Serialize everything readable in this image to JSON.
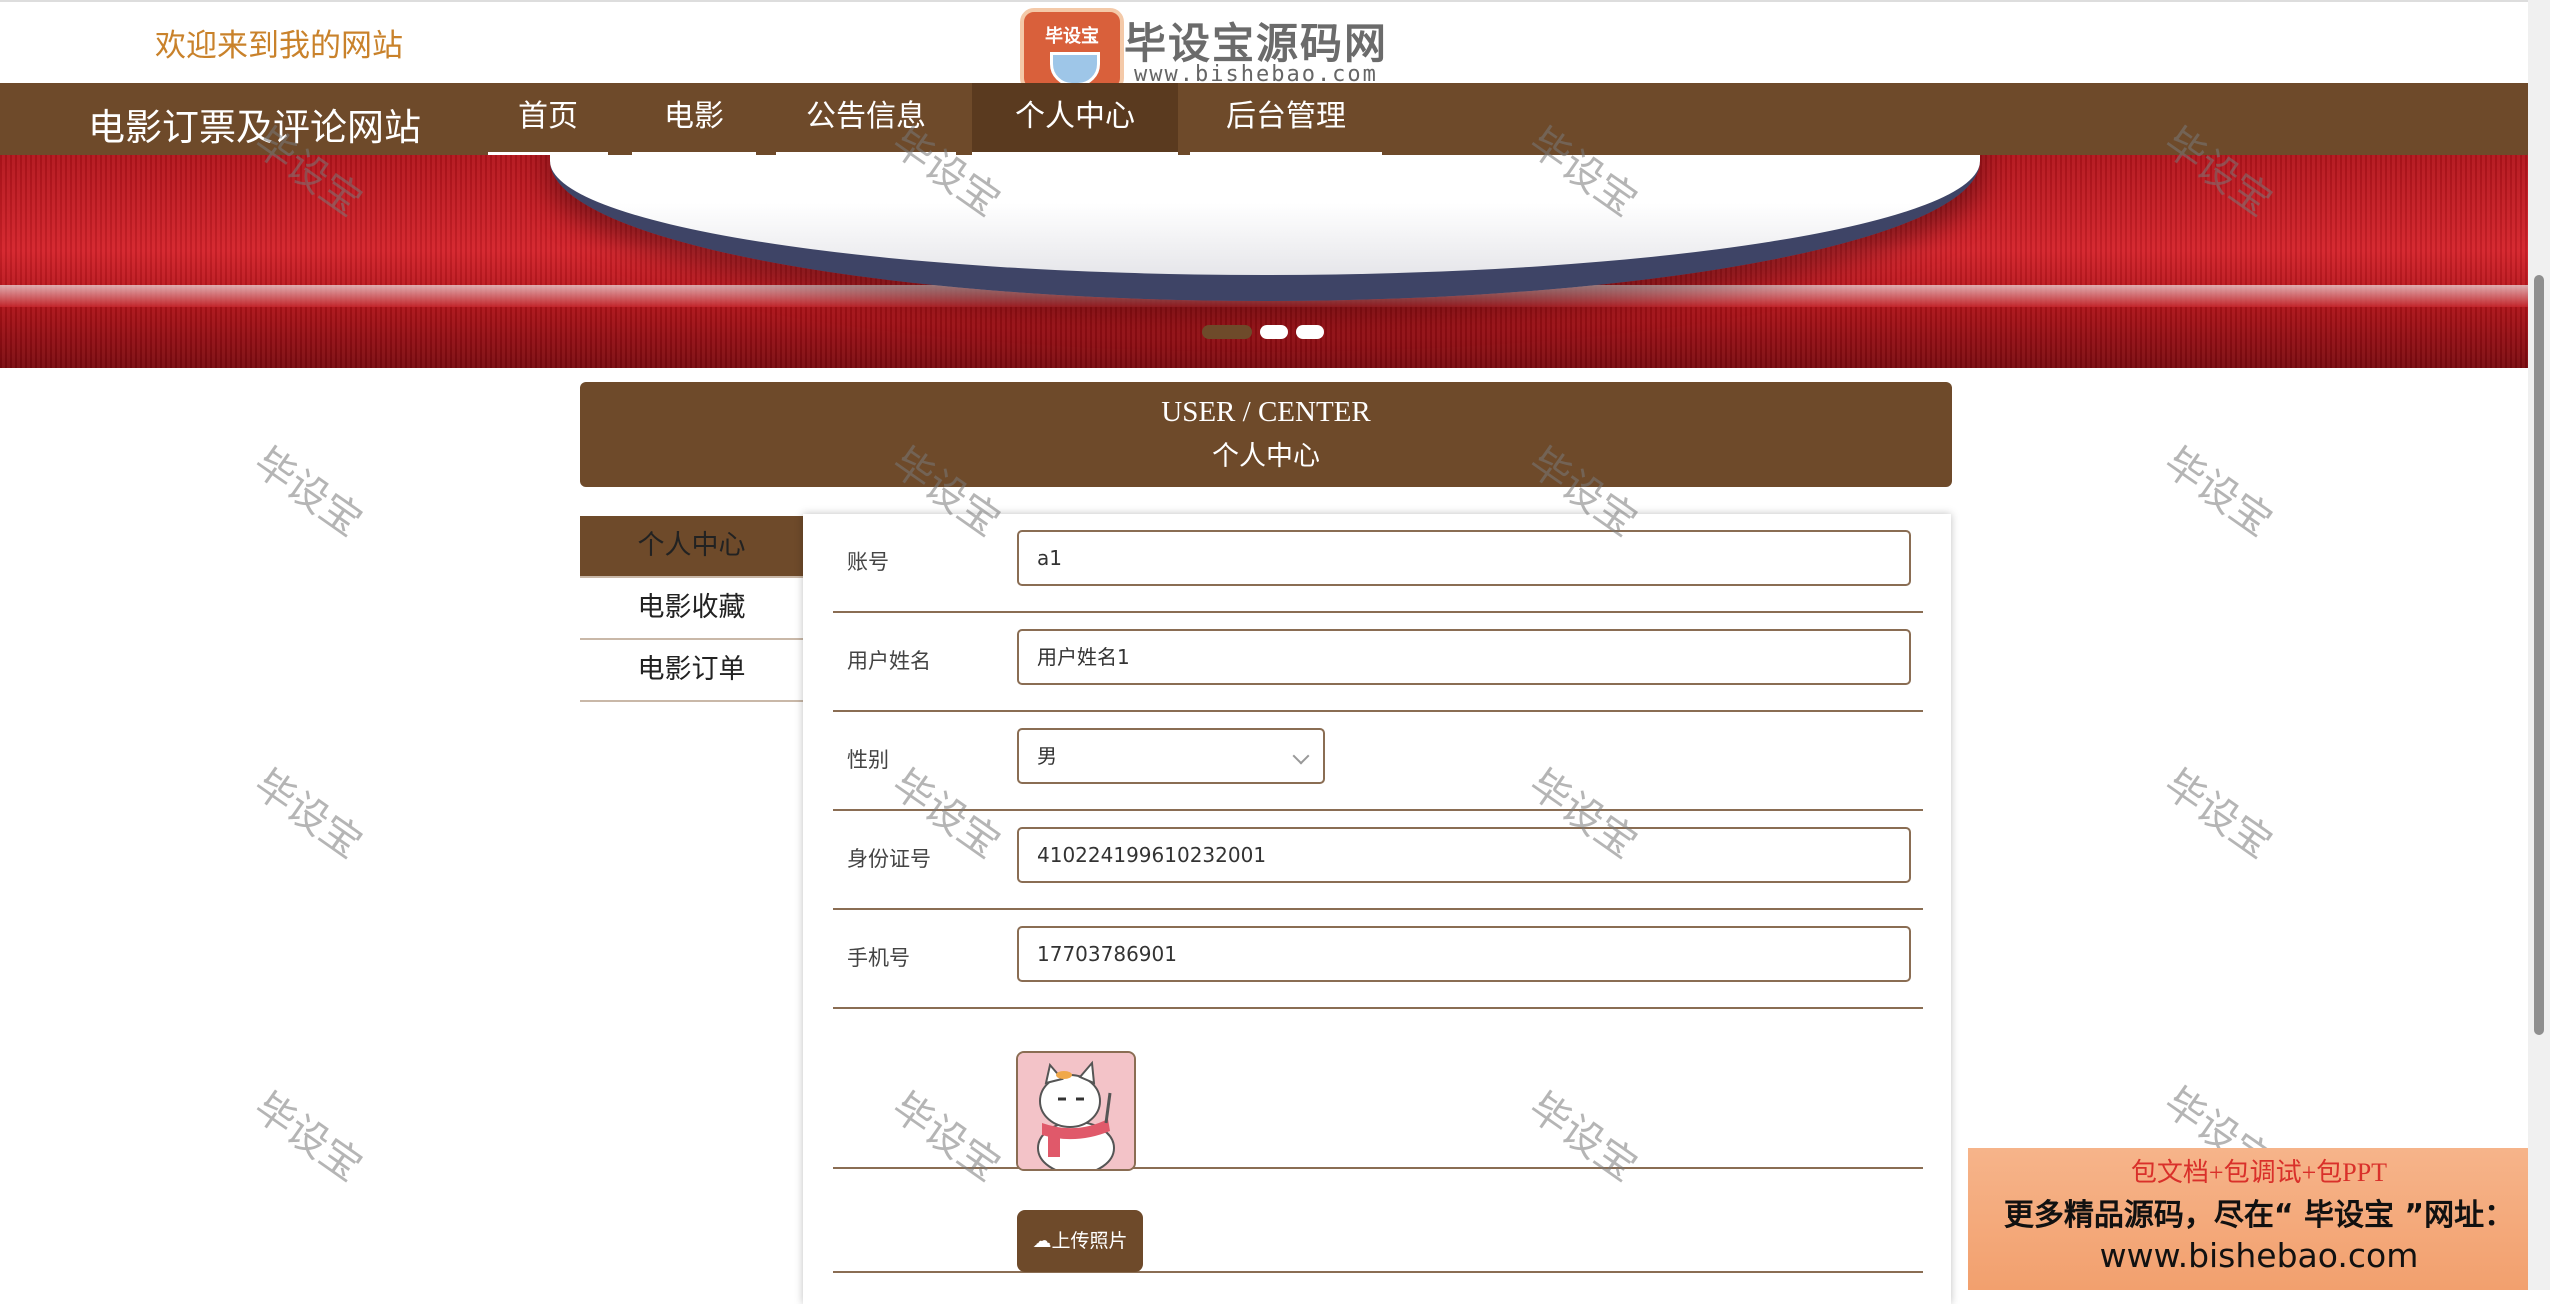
{
  "header": {
    "welcome": "欢迎来到我的网站",
    "logo_badge": "毕设宝",
    "logo_title": "毕设宝源码网",
    "logo_url": "www.bishebao.com"
  },
  "nav": {
    "site_title": "电影订票及评论网站",
    "items": [
      {
        "label": "首页"
      },
      {
        "label": "电影"
      },
      {
        "label": "公告信息"
      },
      {
        "label": "个人中心",
        "active": true
      },
      {
        "label": "后台管理"
      }
    ]
  },
  "banner": {
    "slides": 3,
    "active_slide": 0
  },
  "user_center": {
    "title_en": "USER / CENTER",
    "title_cn": "个人中心"
  },
  "side_menu": {
    "items": [
      {
        "label": "个人中心",
        "active": true
      },
      {
        "label": "电影收藏"
      },
      {
        "label": "电影订单"
      }
    ]
  },
  "form": {
    "account_label": "账号",
    "account_value": "a1",
    "username_label": "用户姓名",
    "username_value": "用户姓名1",
    "gender_label": "性别",
    "gender_value": "男",
    "idcard_label": "身份证号",
    "idcard_value": "410224199610232001",
    "phone_label": "手机号",
    "phone_value": "17703786901",
    "upload_label": "上传照片"
  },
  "watermark_text": "毕设宝",
  "ad": {
    "line1": "包文档+包调试+包PPT",
    "line2": "更多精品源码，尽在“ 毕设宝 ”网址：",
    "line3": "www.bishebao.com"
  },
  "colors": {
    "brand_brown": "#6e4a2a",
    "welcome_orange": "#c9822b",
    "banner_red": "#c8282e"
  }
}
